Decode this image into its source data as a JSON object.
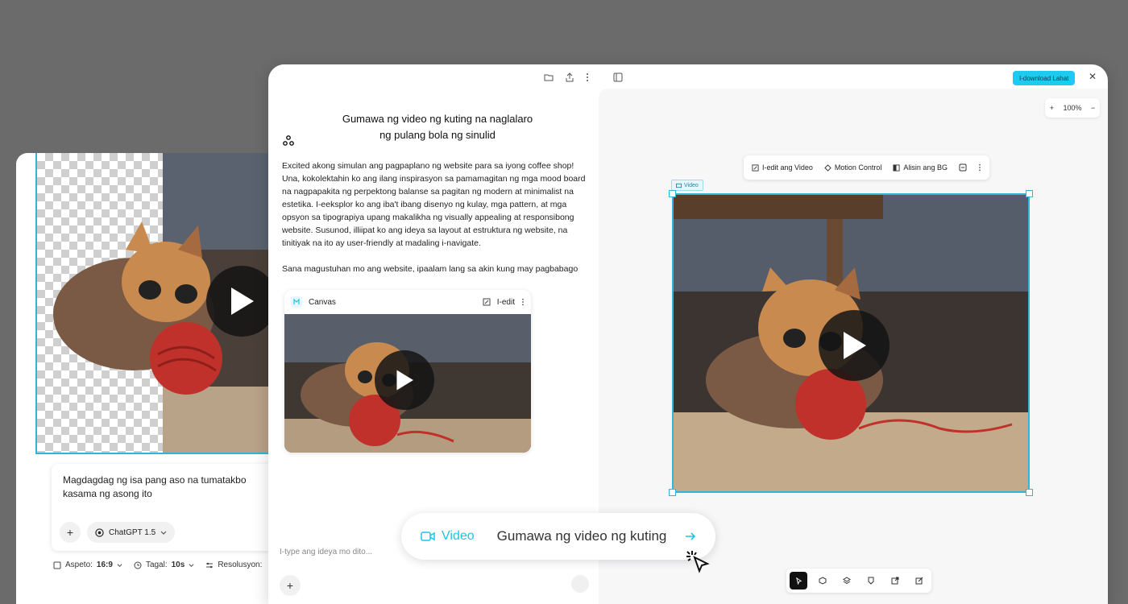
{
  "back_window": {
    "prompt_text": "Magdagdag ng isa pang aso na tumatakbo kasama ng asong ito",
    "model_label": "ChatGPT 1.5",
    "options": {
      "aspect_label": "Aspeto:",
      "aspect_value": "16:9",
      "duration_label": "Tagal:",
      "duration_value": "10s",
      "resolution_label": "Resolusyon:"
    }
  },
  "chat": {
    "title_line1": "Gumawa ng video ng kuting na naglalaro",
    "title_line2": "ng pulang bola ng sinulid",
    "message_p1": "Excited akong simulan ang pagpaplano ng website para sa iyong coffee shop! Una, kokolektahin ko ang ilang inspirasyon sa pamamagitan ng mga mood board na nagpapakita ng perpektong balanse sa pagitan ng modern at minimalist na estetika. I-eeksplor ko ang iba't ibang disenyo ng kulay, mga pattern, at mga opsyon sa tipograpiya upang makalikha ng visually appealing at responsibong website. Susunod, illiipat ko ang ideya sa layout at estruktura ng website, na tinitiyak na ito ay user-friendly at madaling i-navigate.",
    "message_p2": "Sana magustuhan mo ang website, ipaalam lang sa akin kung may pagbabago",
    "canvas_label": "Canvas",
    "edit_label": "I-edit",
    "input_placeholder": "I-type ang ideya mo dito..."
  },
  "editor": {
    "download_all": "I-download Lahat",
    "zoom_level": "100%",
    "toolbar": {
      "edit_video": "I-edit ang Video",
      "motion_control": "Motion Control",
      "remove_bg": "Alisin ang BG"
    },
    "video_tag": "Video"
  },
  "floating_bar": {
    "mode": "Video",
    "prompt": "Gumawa ng video ng kuting"
  },
  "colors": {
    "accent": "#1ecbf0",
    "selection": "#2fb6d6"
  }
}
